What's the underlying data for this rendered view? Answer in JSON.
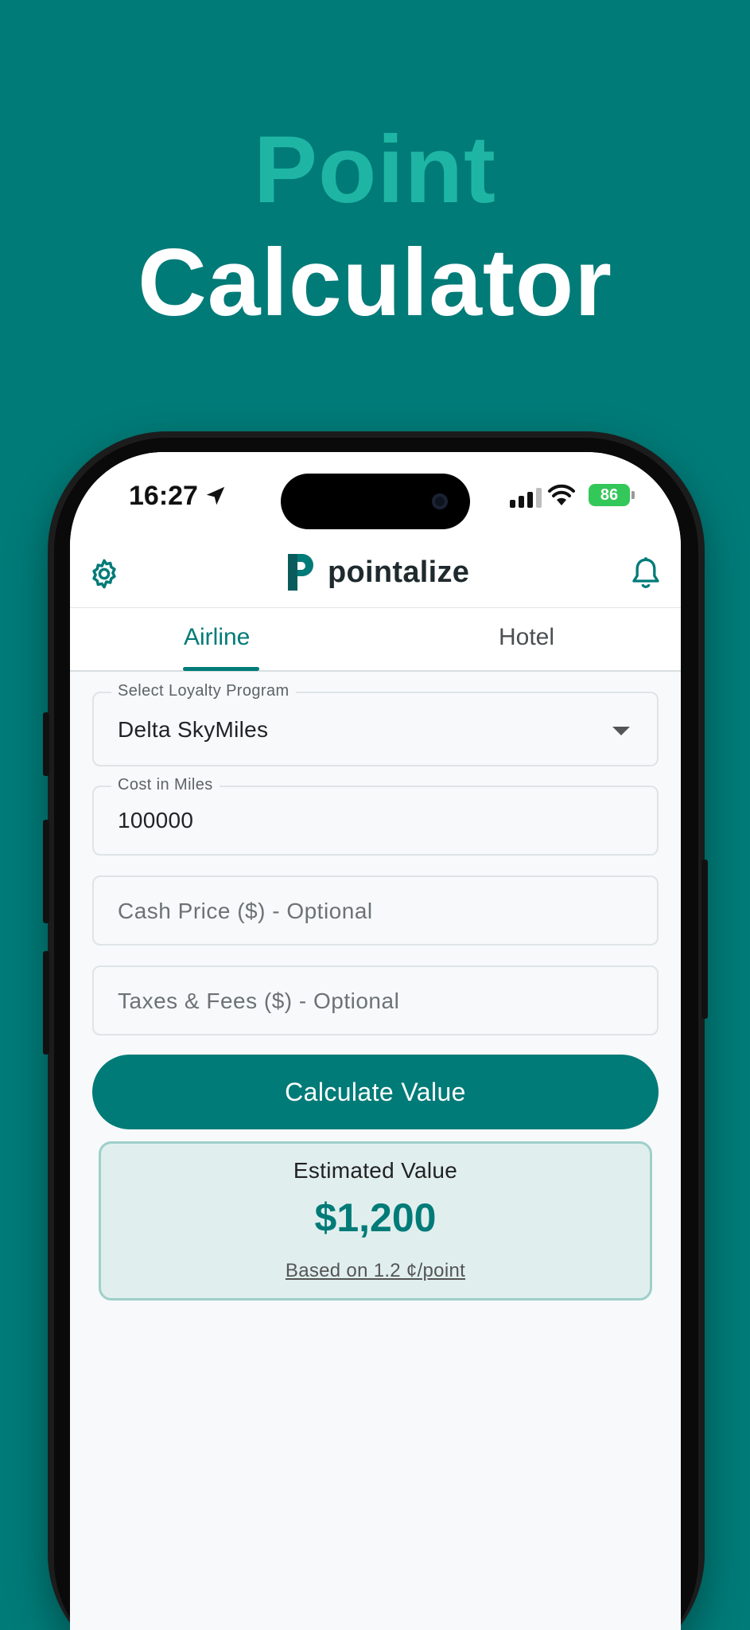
{
  "promo": {
    "line1": "Point",
    "line2": "Calculator"
  },
  "status_bar": {
    "time": "16:27",
    "battery": "86"
  },
  "header": {
    "app_name": "pointalize",
    "logo_letter": "P"
  },
  "tabs": [
    {
      "label": "Airline",
      "active": true
    },
    {
      "label": "Hotel",
      "active": false
    }
  ],
  "form": {
    "loyalty_program": {
      "label": "Select Loyalty Program",
      "value": "Delta SkyMiles"
    },
    "cost_miles": {
      "label": "Cost in Miles",
      "value": "100000"
    },
    "cash_price": {
      "placeholder": "Cash Price ($) - Optional"
    },
    "taxes_fees": {
      "placeholder": "Taxes & Fees ($) - Optional"
    },
    "submit_label": "Calculate Value"
  },
  "result": {
    "label": "Estimated Value",
    "amount": "$1,200",
    "note": "Based on 1.2 ¢/point"
  },
  "colors": {
    "brand": "#017b78",
    "accent": "#1fb5a4",
    "battery": "#34c759"
  }
}
